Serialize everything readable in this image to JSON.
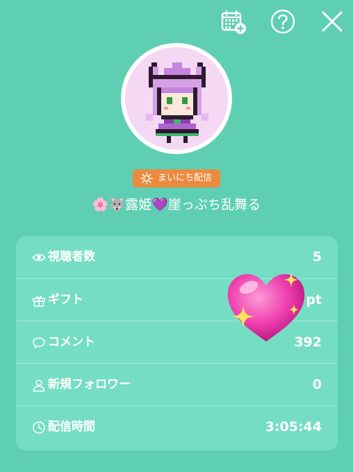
{
  "header": {
    "calendar_icon": "calendar-add-icon",
    "help_icon": "help-icon",
    "close_icon": "close-icon"
  },
  "profile": {
    "badge_label": "まいにち配信",
    "name": "🌸🐺露姫💜崖っぷち乱舞る"
  },
  "stats": [
    {
      "icon": "eye-icon",
      "label": "視聴者数",
      "value": "5"
    },
    {
      "icon": "gift-icon",
      "label": "ギフト",
      "value": "pt"
    },
    {
      "icon": "comment-icon",
      "label": "コメント",
      "value": "392"
    },
    {
      "icon": "person-icon",
      "label": "新規フォロワー",
      "value": "0"
    },
    {
      "icon": "clock-icon",
      "label": "配信時間",
      "value": "3:05:44"
    }
  ],
  "colors": {
    "background": "#5ecfb2",
    "card": "#75ddc3",
    "badge": "#ec8a3e"
  }
}
